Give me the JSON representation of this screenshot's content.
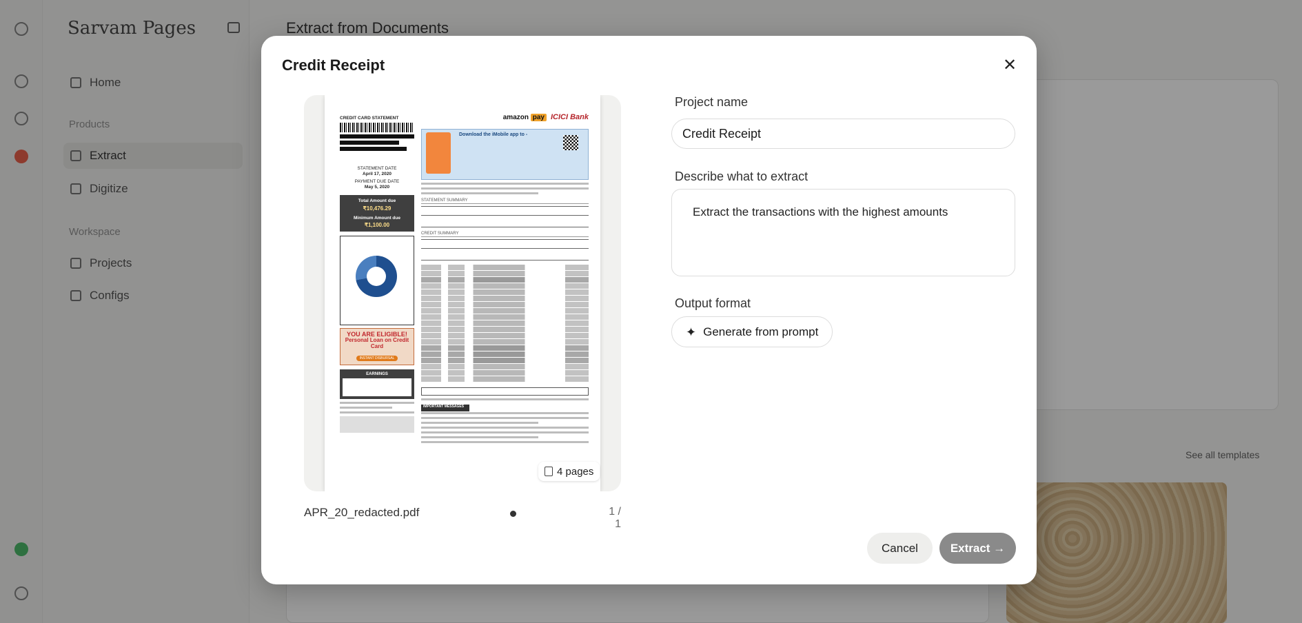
{
  "background": {
    "brand": "Sarvam Pages",
    "page_title": "Extract from Documents",
    "sections": {
      "products": "Products",
      "workspace": "Workspace"
    },
    "nav": [
      {
        "label": "Home"
      },
      {
        "label": "Extract",
        "active": true
      },
      {
        "label": "Digitize"
      },
      {
        "label": "Projects"
      },
      {
        "label": "Configs"
      }
    ],
    "see_all_link": "See all templates"
  },
  "modal": {
    "title": "Credit Receipt",
    "preview": {
      "file_name": "APR_20_redacted.pdf",
      "pages_badge": "4 pages",
      "page_counter": "1 / 1",
      "document": {
        "header": "CREDIT CARD STATEMENT",
        "statement_date_label": "STATEMENT DATE",
        "statement_date": "April 17, 2020",
        "due_date_label": "PAYMENT DUE DATE",
        "due_date": "May 5, 2020",
        "total_due_label": "Total Amount due",
        "total_due": "₹10,476.29",
        "min_due_label": "Minimum Amount due",
        "min_due": "₹1,100.00",
        "eligible_title": "YOU ARE ELIGIBLE!",
        "eligible_sub": "Personal Loan on Credit Card",
        "eligible_pill": "INSTANT DISBURSAL",
        "earnings": "EARNINGS",
        "brand_pay": "amazon",
        "brand_pay_tag": "pay",
        "brand_bank": "ICICI Bank",
        "imobile": "Download the iMobile app to -",
        "summary": "STATEMENT SUMMARY",
        "credit_summary": "CREDIT SUMMARY",
        "important": "IMPORTANT MESSAGES"
      }
    },
    "form": {
      "project_name_label": "Project name",
      "project_name_value": "Credit Receipt",
      "describe_label": "Describe what to extract",
      "describe_value": "Extract the transactions with the highest amounts",
      "output_format_label": "Output format",
      "generate_label": "Generate from prompt"
    },
    "buttons": {
      "cancel": "Cancel",
      "extract": "Extract →"
    }
  },
  "colors": {
    "primary_disabled": "#8a8a8a",
    "overlay": "rgba(30,30,30,0.45)",
    "highlight_row": "#ead8bb"
  }
}
